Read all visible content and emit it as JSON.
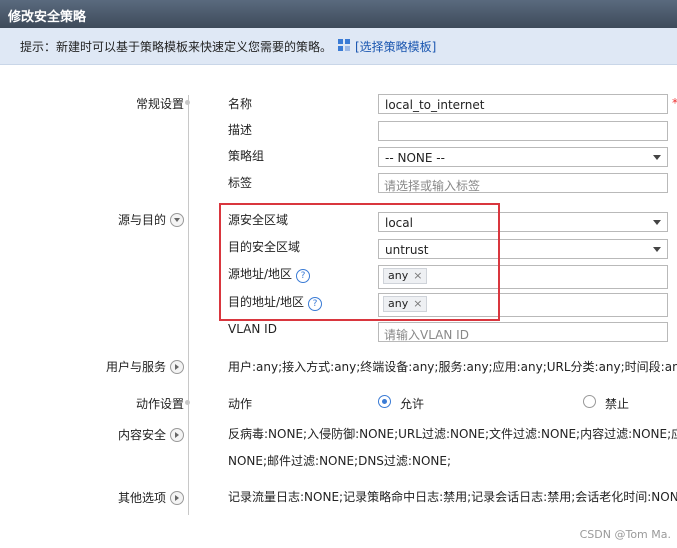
{
  "window": {
    "title": "修改安全策略"
  },
  "tip": {
    "text": "提示：新建时可以基于策略模板来快速定义您需要的策略。",
    "link": "[选择策略模板]"
  },
  "sections": {
    "general": "常规设置",
    "src_dst": "源与目的",
    "user_service": "用户与服务",
    "action": "动作设置",
    "content": "内容安全",
    "other": "其他选项"
  },
  "fields": {
    "name_label": "名称",
    "name_value": "local_to_internet",
    "desc_label": "描述",
    "desc_value": "",
    "group_label": "策略组",
    "group_value": "-- NONE --",
    "tag_label": "标签",
    "tag_placeholder": "请选择或输入标签",
    "src_zone_label": "源安全区域",
    "src_zone_value": "local",
    "dst_zone_label": "目的安全区域",
    "dst_zone_value": "untrust",
    "src_addr_label": "源地址/地区",
    "src_addr_tag": "any",
    "dst_addr_label": "目的地址/地区",
    "dst_addr_tag": "any",
    "vlan_label": "VLAN ID",
    "vlan_placeholder": "请输入VLAN ID"
  },
  "user_service_summary": "用户:any;接入方式:any;终端设备:any;服务:any;应用:any;URL分类:any;时间段:any;",
  "action": {
    "label": "动作",
    "allow": "允许",
    "deny": "禁止",
    "selected": "允许"
  },
  "content_summary": {
    "line1": "反病毒:NONE;入侵防御:NONE;URL过滤:NONE;文件过滤:NONE;内容过滤:NONE;应用",
    "line2": "NONE;邮件过滤:NONE;DNS过滤:NONE;"
  },
  "other_summary": "记录流量日志:NONE;记录策略命中日志:禁用;记录会话日志:禁用;会话老化时间:NONE",
  "required_mark": "*",
  "help_glyph": "?",
  "tag_remove_glyph": "×",
  "watermark": "CSDN @Tom Ma.",
  "colors": {
    "accent": "#3a7bd5",
    "highlight": "#d9363e",
    "tip_bg": "#dfe8f5",
    "link": "#1a56b0"
  }
}
